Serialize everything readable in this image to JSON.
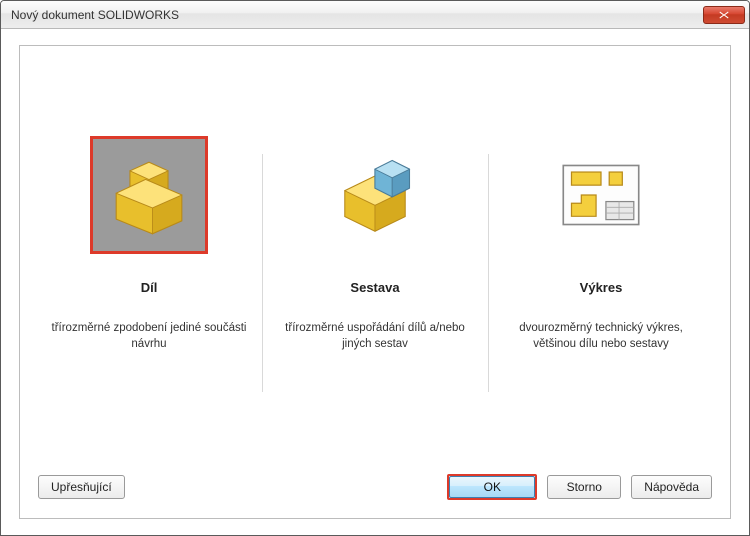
{
  "window": {
    "title": "Nový dokument SOLIDWORKS"
  },
  "options": {
    "part": {
      "title": "Díl",
      "desc": "třírozměrné zpodobení jediné součásti návrhu",
      "selected": true
    },
    "assembly": {
      "title": "Sestava",
      "desc": "třírozměrné uspořádání dílů a/nebo jiných sestav",
      "selected": false
    },
    "drawing": {
      "title": "Výkres",
      "desc": "dvourozměrný technický výkres, většinou dílu nebo sestavy",
      "selected": false
    }
  },
  "buttons": {
    "advanced": "Upřesňující",
    "ok": "OK",
    "cancel": "Storno",
    "help": "Nápověda"
  }
}
